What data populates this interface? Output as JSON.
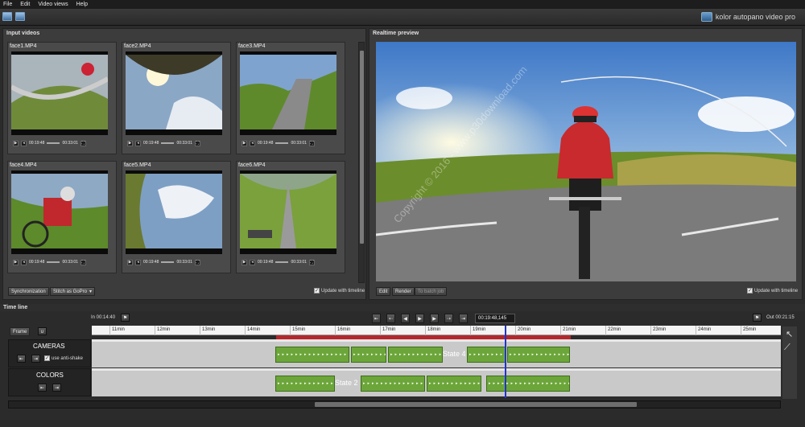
{
  "menu": [
    "File",
    "Edit",
    "Video views",
    "Help"
  ],
  "brand": {
    "text": "kolor autopano video pro",
    "logo_icon": "kolor-logo-icon"
  },
  "toolbar_icons": [
    "layout-icon-1",
    "layout-icon-2"
  ],
  "input_videos": {
    "title": "Input videos",
    "thumbs": [
      {
        "name": "face1.MP4",
        "time": "00:19:48",
        "duration": "00:33:01"
      },
      {
        "name": "face2.MP4",
        "time": "00:19:48",
        "duration": "00:33:01"
      },
      {
        "name": "face3.MP4",
        "time": "00:19:48",
        "duration": "00:33:01"
      },
      {
        "name": "face4.MP4",
        "time": "00:19:48",
        "duration": "00:33:01"
      },
      {
        "name": "face5.MP4",
        "time": "00:19:48",
        "duration": "00:33:01"
      },
      {
        "name": "face6.MP4",
        "time": "00:19:48",
        "duration": "00:33:01"
      }
    ],
    "sync_button": "Synchronization",
    "stitch_dropdown": "Stitch as GoPro",
    "update_checkbox": "Update with timeline"
  },
  "preview": {
    "title": "Realtime preview",
    "edit_button": "Edit",
    "render_button": "Render",
    "batch_button": "To batch job",
    "update_checkbox": "Update with timeline",
    "watermark": "Copyright © 2016 - www.p30download.com"
  },
  "timeline": {
    "title": "Time line",
    "in_label": "In 00:14:40",
    "out_label": "Out 00:21:15",
    "current_time": "00:19:48,145",
    "frame_button": "Frame",
    "ruler_ticks": [
      "11min",
      "12min",
      "13min",
      "14min",
      "15min",
      "16min",
      "17min",
      "18min",
      "19min",
      "20min",
      "21min",
      "22min",
      "23min",
      "24min",
      "25min"
    ],
    "tracks": [
      {
        "name": "CAMERAS",
        "checkbox": "use anti-shake",
        "state": "State 4"
      },
      {
        "name": "COLORS",
        "state": "State 2"
      }
    ],
    "seg_dots": "•••",
    "seg_arrows": "▸▸▸▸▸▸▸▸▸▸▸▸▸▸▸▸▸▸▸▸"
  },
  "colors": {
    "accent_red": "#b3282d",
    "segment_green": "#6ca63a",
    "playhead_blue": "#2233cc"
  }
}
